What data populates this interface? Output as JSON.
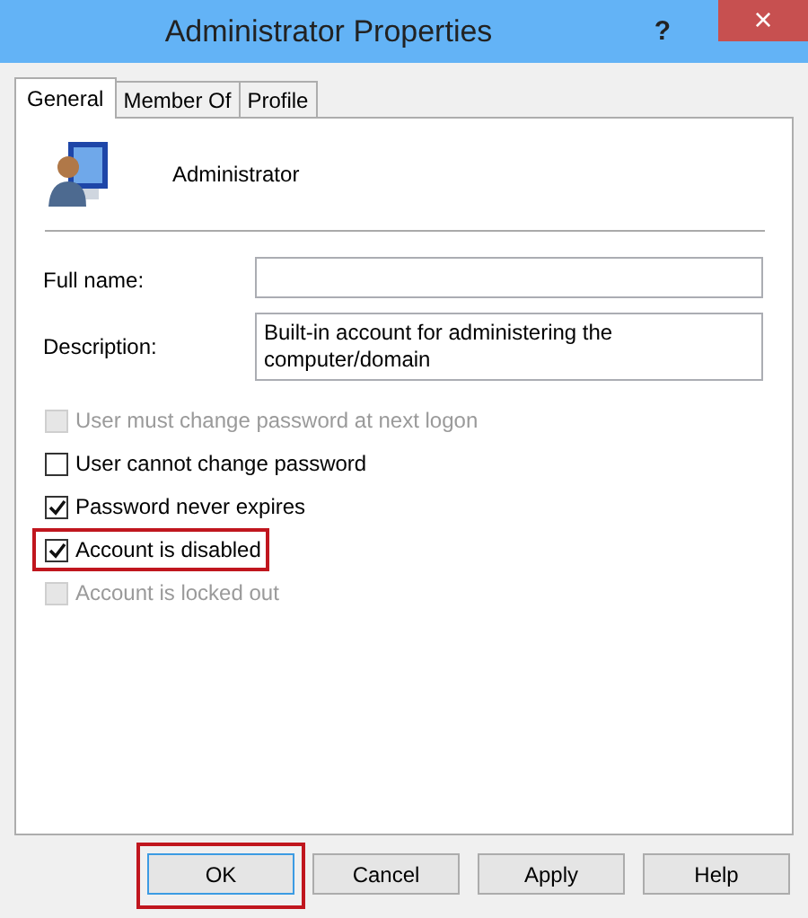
{
  "window": {
    "title": "Administrator Properties",
    "help_button": "?",
    "close_button": "×"
  },
  "tabs": [
    {
      "label": "General",
      "selected": true
    },
    {
      "label": "Member Of",
      "selected": false
    },
    {
      "label": "Profile",
      "selected": false
    }
  ],
  "account": {
    "name": "Administrator"
  },
  "fields": [
    {
      "label": "Full name:"
    },
    {
      "label": "Description:",
      "value": "Built-in account for administering the computer/domain"
    }
  ],
  "options": [
    {
      "label": "User must change password at next logon",
      "checked": false,
      "disabled": true,
      "highlighted": false
    },
    {
      "label": "User cannot change password",
      "checked": false,
      "disabled": false,
      "highlighted": false
    },
    {
      "label": "Password never expires",
      "checked": true,
      "disabled": false,
      "highlighted": false
    },
    {
      "label": "Account is disabled",
      "checked": true,
      "disabled": false,
      "highlighted": true
    },
    {
      "label": "Account is locked out",
      "checked": false,
      "disabled": true,
      "highlighted": false
    }
  ],
  "buttons": [
    {
      "label": "OK",
      "default": true,
      "highlighted": true
    },
    {
      "label": "Cancel",
      "default": false,
      "highlighted": false
    },
    {
      "label": "Apply",
      "default": false,
      "highlighted": false
    },
    {
      "label": "Help",
      "default": false,
      "highlighted": false
    }
  ]
}
